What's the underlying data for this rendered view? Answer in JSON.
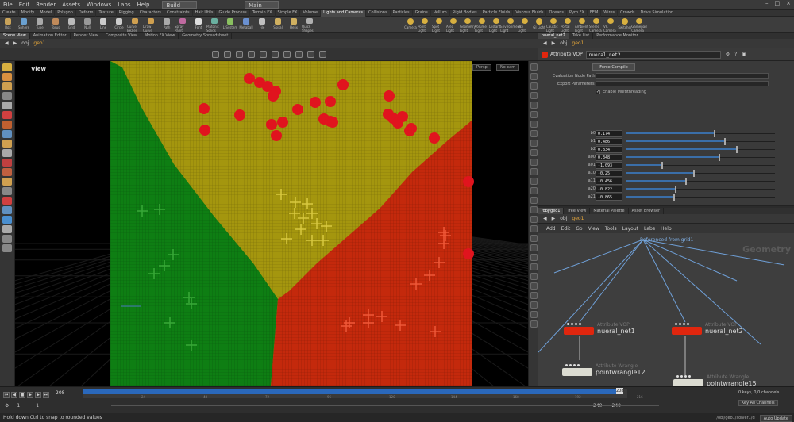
{
  "menubar": {
    "items": [
      "File",
      "Edit",
      "Render",
      "Assets",
      "Windows",
      "Labs",
      "Help"
    ],
    "desktop": "Build",
    "main_label": "Main"
  },
  "shelf_tabs": [
    "Create",
    "Modify",
    "Model",
    "Polygon",
    "Deform",
    "Texture",
    "Rigging",
    "Characters",
    "Constraints",
    "Hair Utils",
    "Guide Process",
    "Terrain FX",
    "Simple FX",
    "Volume",
    "Lights and Cameras",
    "Collisions",
    "Particles",
    "Grains",
    "Vellum",
    "Rigid Bodies",
    "Particle Fluids",
    "Viscous Fluids",
    "Oceans",
    "Pyro FX",
    "FEM",
    "Wires",
    "Crowds",
    "Drive Simulation"
  ],
  "shelf_tools": [
    "Box",
    "Sphere",
    "Tube",
    "Torus",
    "Grid",
    "Null",
    "Line",
    "Circle",
    "Curve Bezier",
    "Draw Curve",
    "Path",
    "Spray Paint",
    "Font",
    "Platonic Solids",
    "L-System",
    "Metaball",
    "File",
    "Spiral",
    "Helix",
    "Quick Shapes"
  ],
  "shelf_tools_lights": [
    "Camera",
    "Point Light",
    "Spot Light",
    "Area Light",
    "Geometry Light",
    "Volume Light",
    "Distant Light",
    "Environment Light",
    "Sky Light",
    "GI Light",
    "Caustic Light",
    "Portal Light",
    "Ambient Light",
    "Stereo Camera",
    "VR Camera",
    "Switcher",
    "Gamepad Camera"
  ],
  "left_tabs": [
    "Scene View",
    "Animation Editor",
    "Render View",
    "Composite View",
    "Motion FX View",
    "Geometry Spreadsheet"
  ],
  "left_path": [
    "obj",
    "geo1"
  ],
  "viewport": {
    "label": "View",
    "persp": "Persp",
    "cam": "No cam"
  },
  "right_tabs": [
    "nueral_net2",
    "Take List",
    "Performance Monitor"
  ],
  "right_path": [
    "obj",
    "geo1"
  ],
  "params": {
    "node_type": "Attribute VOP",
    "node_name": "nueral_net2",
    "force_compile": "Force Compile",
    "eval_label": "Evaluation Node Path",
    "export_label": "Export Parameters",
    "multithread_label": "Enable Multithreading",
    "rows": [
      {
        "name": "b0",
        "value": "0.174",
        "pos": 0.59
      },
      {
        "name": "b1",
        "value": "0.486",
        "pos": 0.66
      },
      {
        "name": "b2",
        "value": "0.834",
        "pos": 0.74
      },
      {
        "name": "a00",
        "value": "0.348",
        "pos": 0.62
      },
      {
        "name": "a01",
        "value": "-1.093",
        "pos": 0.24
      },
      {
        "name": "a10",
        "value": "-0.25",
        "pos": 0.45
      },
      {
        "name": "a11",
        "value": "-0.456",
        "pos": 0.4
      },
      {
        "name": "a20",
        "value": "-0.822",
        "pos": 0.33
      },
      {
        "name": "a21",
        "value": "-0.865",
        "pos": 0.32
      }
    ]
  },
  "net_tabs": [
    "/obj/geo1",
    "Tree View",
    "Material Palette",
    "Asset Browser"
  ],
  "net_path": [
    "obj",
    "geo1"
  ],
  "net_menu": [
    "Add",
    "Edit",
    "Go",
    "View",
    "Tools",
    "Layout",
    "Labs",
    "Help"
  ],
  "network": {
    "context_label": "Geometry",
    "ref_label": "Referenced from grid1",
    "nodes": [
      {
        "type": "Attribute VOP",
        "name": "nueral_net1",
        "color": "#e0260e"
      },
      {
        "type": "Attribute VOP",
        "name": "nueral_net2",
        "color": "#e0260e"
      },
      {
        "type": "Attribute Wrangle",
        "name": "pointwrangle12",
        "color": "#dcdcd2"
      },
      {
        "type": "Attribute Wrangle",
        "name": "pointwrangle15",
        "color": "#dcdcd2"
      }
    ]
  },
  "timeline": {
    "frame": "208",
    "cursor": "208",
    "ticks": [
      "24",
      "48",
      "72",
      "96",
      "120",
      "144",
      "168",
      "192",
      "216"
    ],
    "start": "1",
    "start2": "1",
    "end": "240",
    "end2": "240",
    "keys_info": "0 keys, 0/0 channels",
    "key_all": "Key All Channels"
  },
  "status": {
    "hint": "Hold down Ctrl to snap to rounded values",
    "path": "/obj/geo1/solver1/d",
    "auto_update": "Auto Update"
  },
  "colors": {
    "green_region": "#0e7e13",
    "yellow_region": "#a4960e",
    "red_region": "#c4290c",
    "red_point": "#e0141e",
    "accent_blue": "#2a68bb"
  }
}
